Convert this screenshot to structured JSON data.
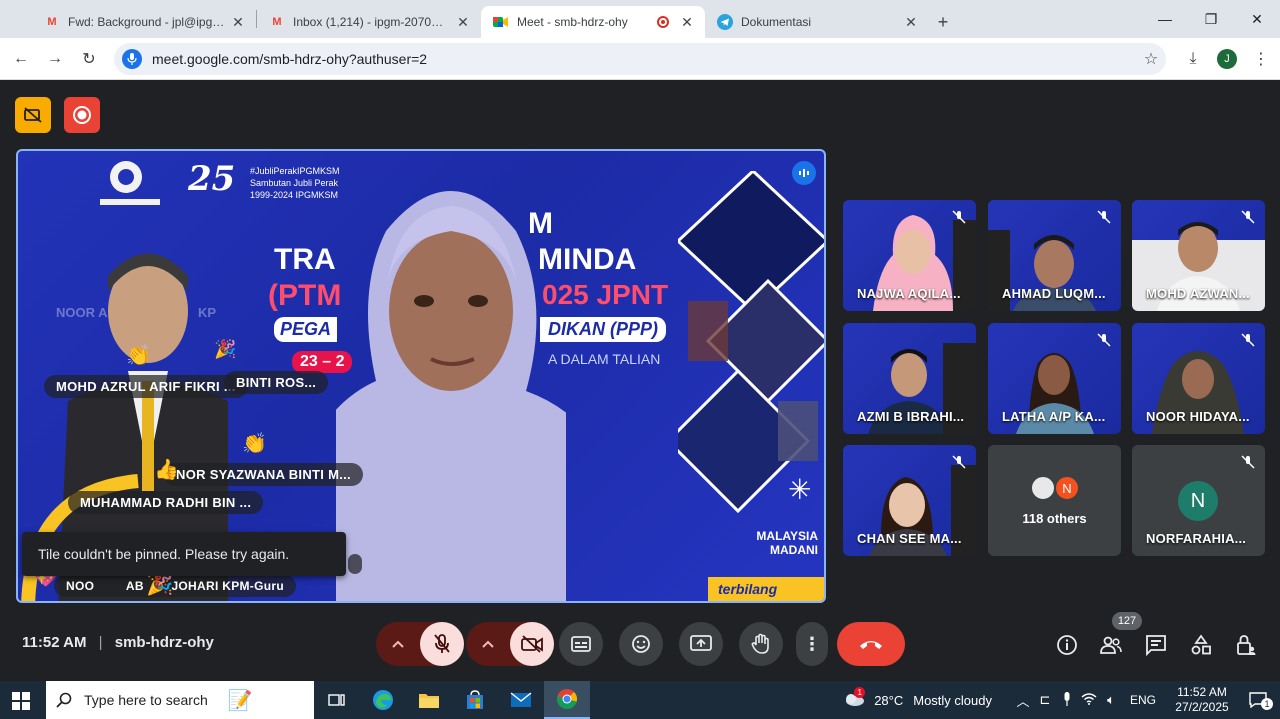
{
  "browser": {
    "tabs": [
      {
        "title": "Fwd: Background - jpl@ipgmksm",
        "icon": "gmail-icon"
      },
      {
        "title": "Inbox (1,214) - ipgm-2070@moe",
        "icon": "gmail-icon"
      },
      {
        "title": "Meet - smb-hdrz-ohy",
        "icon": "meet-icon",
        "active": true
      },
      {
        "title": "Dokumentasi",
        "icon": "telegram-icon"
      }
    ],
    "url": "meet.google.com/smb-hdrz-ohy?authuser=2",
    "profile_initial": "J"
  },
  "meet": {
    "main_tile": {
      "banner_hashtag": "#JubliPerakIPGMKSM",
      "banner_sub1": "Sambutan Jubli Perak",
      "banner_sub2": "1999-2024 IPGMKSM",
      "banner_line1_left": "TRA",
      "banner_line1_right": "MINDA",
      "banner_line2_left": "(PTM",
      "banner_line2_right": "025 JPNT",
      "banner_line3_left": "PEGA",
      "banner_line3_right": "DIKAN (PPP)",
      "banner_date": "23 – 2",
      "banner_online": "A DALAM TALIAN",
      "banner_m": "M",
      "logo_text": "MALAYSIA MADANI",
      "footer_text": "terbilang",
      "watermark": "NOOR A",
      "watermark2": "KP",
      "reaction_names": [
        "MOHD AZRUL ARIF FIKRI ...",
        "BINTI ROS...",
        "NOR SYAZWANA BINTI M...",
        "MUHAMMAD RADHI BIN ...",
        "NOO",
        "AB",
        "JOHARI KPM-Guru"
      ]
    },
    "toast": "Tile couldn't be pinned. Please try again.",
    "participants": [
      {
        "name": "NAJWA AQILA..."
      },
      {
        "name": "AHMAD LUQM..."
      },
      {
        "name": "MOHD AZWAN..."
      },
      {
        "name": "AZMI B IBRAHI..."
      },
      {
        "name": "LATHA A/P KA..."
      },
      {
        "name": "NOOR HIDAYA..."
      },
      {
        "name": "CHAN SEE MA..."
      },
      {
        "name": "118 others",
        "avatar": "N"
      },
      {
        "name": "NORFARAHIA...",
        "avatar": "N"
      }
    ],
    "time": "11:52 AM",
    "meeting_code": "smb-hdrz-ohy",
    "people_count": "127"
  },
  "taskbar": {
    "search_placeholder": "Type here to search",
    "weather_temp": "28°C",
    "weather_desc": "Mostly cloudy",
    "weather_badge": "1",
    "lang": "ENG",
    "time": "11:52 AM",
    "date": "27/2/2025",
    "notif_count": "1"
  },
  "colors": {
    "meet_bg": "#202124",
    "accent_blue": "#8ab4f8",
    "end_call_red": "#ea4335",
    "mic_off_bg": "#f9dedc",
    "taskbar": "#1b2b3a"
  }
}
